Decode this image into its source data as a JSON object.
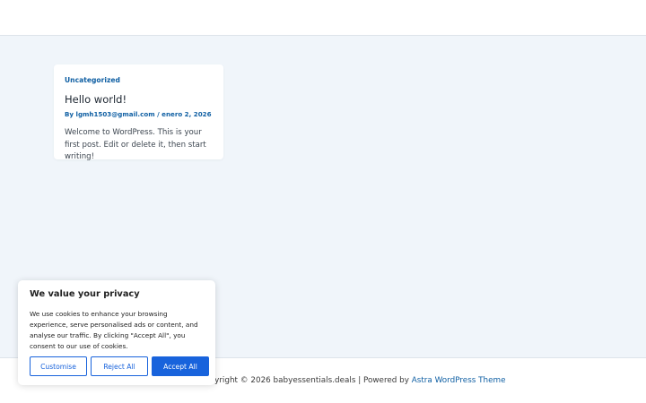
{
  "post": {
    "category": "Uncategorized",
    "title": "Hello world!",
    "meta_prefix": "By",
    "author": "lgmh1503@gmail.com",
    "separator": "/",
    "date": "enero 2, 2026",
    "excerpt": "Welcome to WordPress. This is your first post. Edit or delete it, then start writing!"
  },
  "footer": {
    "copyright_text": "Copyright © 2026 babyessentials.deals | Powered by",
    "theme_link": "Astra WordPress Theme"
  },
  "cookie_banner": {
    "title": "We value your privacy",
    "description": "We use cookies to enhance your browsing experience, serve personalised ads or content, and analyse our traffic. By clicking \"Accept All\", you consent to our use of cookies.",
    "customise_label": "Customise",
    "reject_label": "Reject All",
    "accept_label": "Accept All"
  },
  "colors": {
    "accent": "#1863dc",
    "link": "#0f5fa3",
    "page_background": "#f0f5fa"
  }
}
